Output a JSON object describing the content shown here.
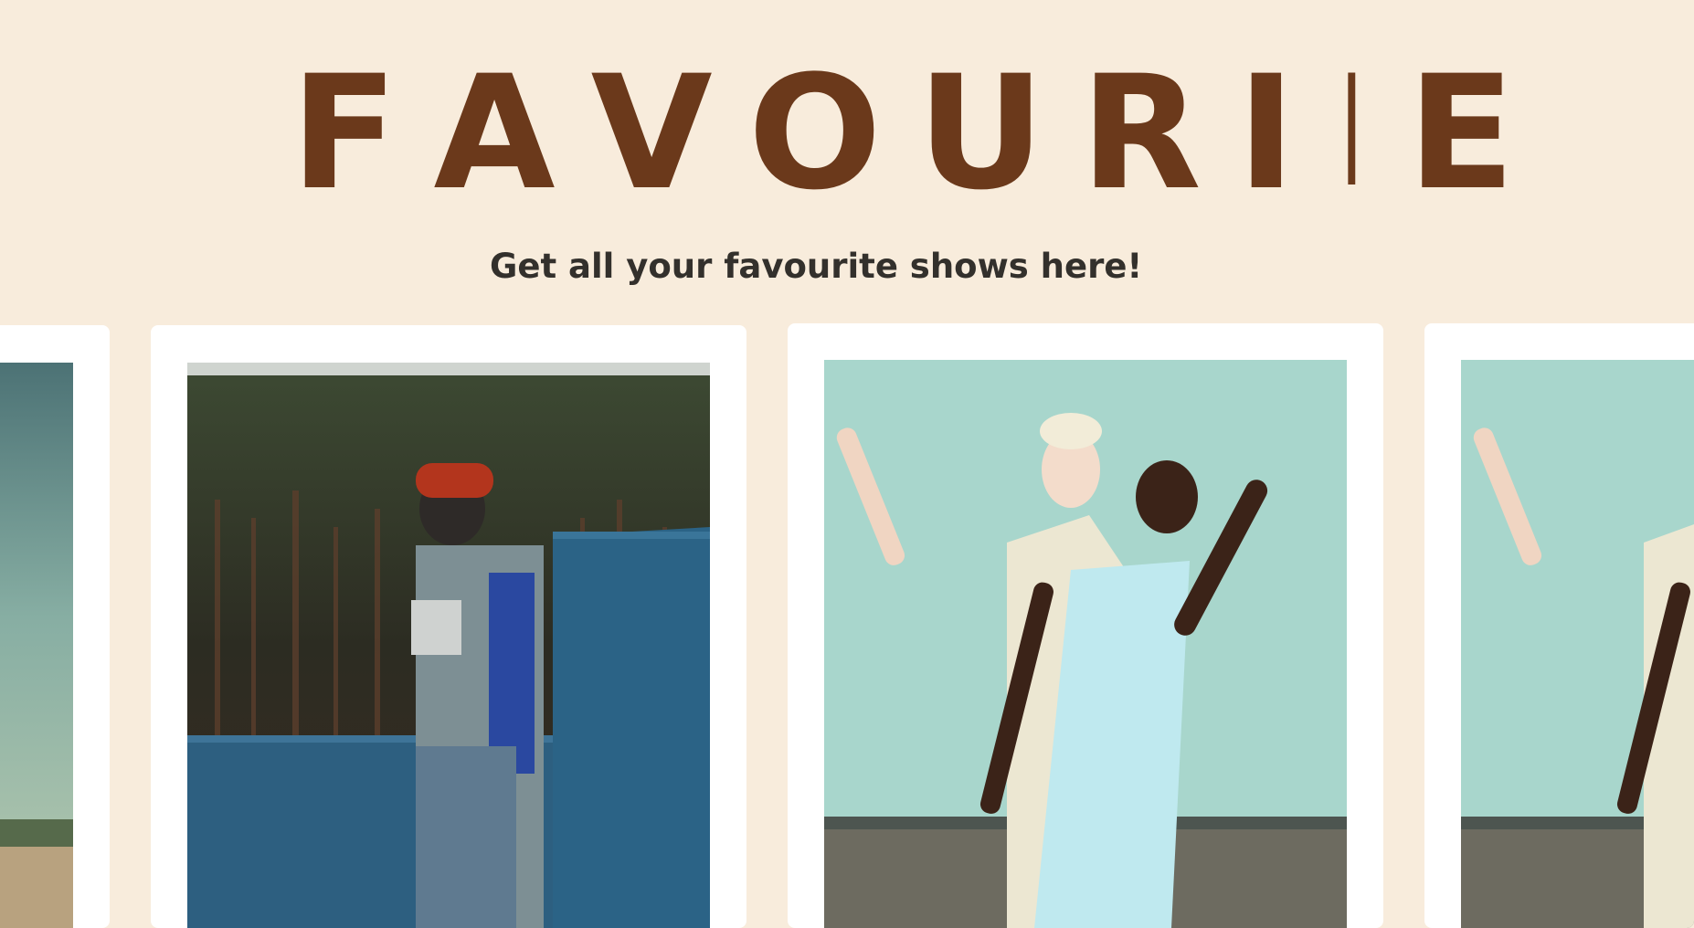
{
  "header": {
    "title": "FAVOURI E",
    "title_display": [
      "F",
      "A",
      "V",
      "O",
      "U",
      "R",
      "I",
      "I",
      "E"
    ],
    "subtitle": "Get all your favourite shows here!"
  },
  "cards": [
    {
      "photo_name": "teal-sky-landscape-photo"
    },
    {
      "photo_name": "man-red-beanie-forest-photo"
    },
    {
      "photo_name": "dancers-teal-wall-photo"
    },
    {
      "photo_name": "dancers-teal-wall-photo-repeat"
    }
  ],
  "colors": {
    "background": "#f8ecdc",
    "title": "#6b391b",
    "subtitle": "#33302c",
    "card": "#ffffff"
  }
}
